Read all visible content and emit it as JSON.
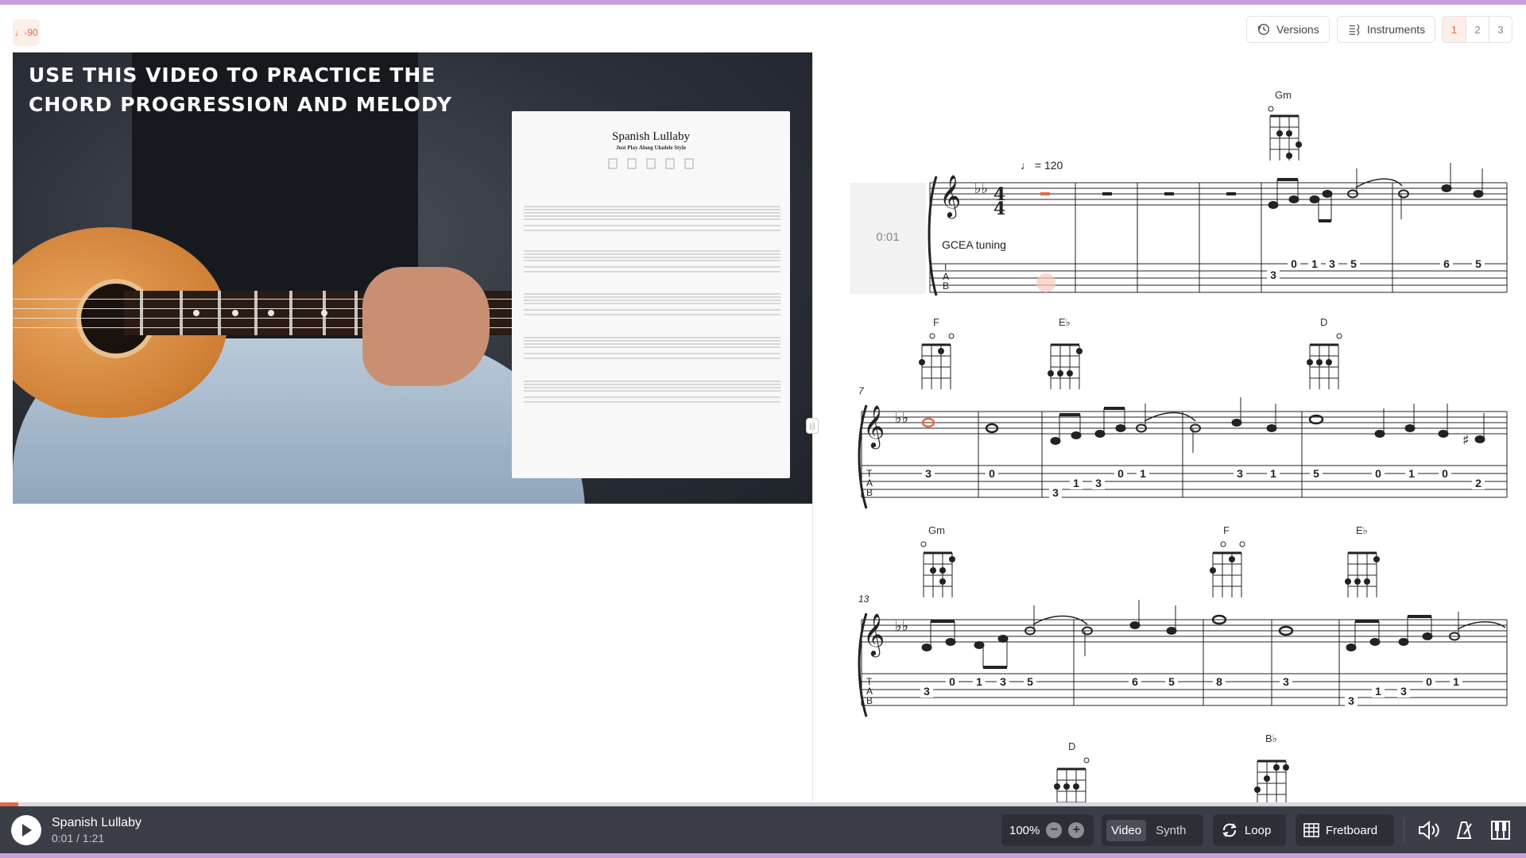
{
  "header": {
    "tempo_icon": "♩-90",
    "versions_label": "Versions",
    "instruments_label": "Instruments",
    "pages": [
      "1",
      "2",
      "3"
    ],
    "active_page": "1"
  },
  "video": {
    "caption_line1": "USE THIS VIDEO TO PRACTICE THE",
    "caption_line2": "CHORD PROGRESSION AND MELODY",
    "sheet_title": "Spanish Lullaby",
    "sheet_subtitle": "Just Play Along Ukulele Style"
  },
  "score": {
    "timestamp": "0:01",
    "tuning": "GCEA tuning",
    "tempo": "= 120",
    "measure_numbers": [
      "7",
      "13"
    ],
    "chords_row1": [
      "Gm"
    ],
    "chords_row2": [
      "F",
      "E♭",
      "D"
    ],
    "chords_row3": [
      "Gm",
      "F",
      "E♭"
    ],
    "chords_row4": [
      "D",
      "B♭"
    ],
    "tab_row1": [
      "3",
      "0",
      "1",
      "3",
      "5",
      "6",
      "5"
    ],
    "tab_row2": [
      "3",
      "0",
      "3",
      "1",
      "3",
      "0",
      "1",
      "3",
      "1",
      "5",
      "0",
      "1",
      "0",
      "2"
    ],
    "tab_row3": [
      "3",
      "0",
      "1",
      "3",
      "5",
      "6",
      "5",
      "8",
      "3",
      "3",
      "1",
      "3",
      "0",
      "1"
    ]
  },
  "player": {
    "title": "Spanish Lullaby",
    "time": "0:01 / 1:21",
    "progress": 0.012,
    "zoom": "100%",
    "video_label": "Video",
    "synth_label": "Synth",
    "loop_label": "Loop",
    "fretboard_label": "Fretboard"
  },
  "colors": {
    "accent": "#e2694a",
    "player_bg": "#3b3e46",
    "frame_accent": "#c9a0dc"
  }
}
